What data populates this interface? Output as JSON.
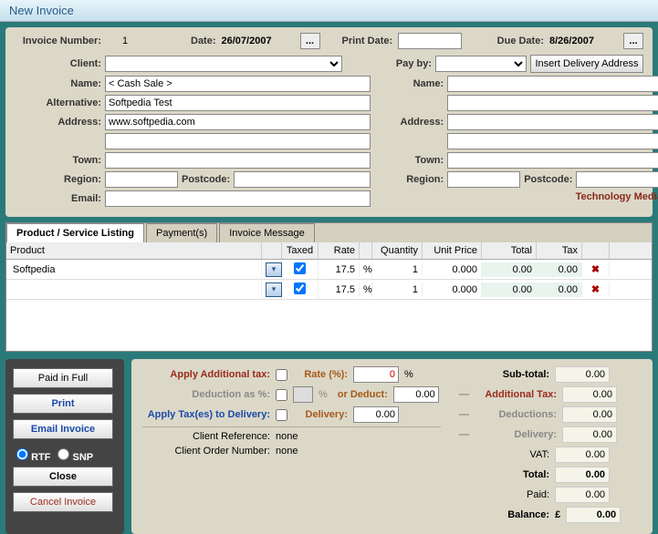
{
  "title": "New Invoice",
  "header": {
    "invoice_number_label": "Invoice Number:",
    "invoice_number": "1",
    "date_label": "Date:",
    "date": "26/07/2007",
    "print_date_label": "Print Date:",
    "print_date": "",
    "due_date_label": "Due Date:",
    "due_date": "8/26/2007",
    "ellipsis": "..."
  },
  "client_row": {
    "client_label": "Client:",
    "payby_label": "Pay by:",
    "insert_btn": "Insert Delivery Address"
  },
  "left": {
    "name_label": "Name:",
    "name": "< Cash Sale >",
    "alt_label": "Alternative:",
    "alt": "Softpedia Test",
    "addr_label": "Address:",
    "addr": "www.softpedia.com",
    "town_label": "Town:",
    "region_label": "Region:",
    "postcode_label": "Postcode:",
    "email_label": "Email:"
  },
  "right": {
    "name_label": "Name:",
    "addr_label": "Address:",
    "town_label": "Town:",
    "region_label": "Region:",
    "postcode_label": "Postcode:"
  },
  "footer_note": "Technology Media, Bradford.",
  "tabs": {
    "t1": "Product / Service Listing",
    "t2": "Payment(s)",
    "t3": "Invoice Message"
  },
  "grid": {
    "h_product": "Product",
    "h_taxed": "Taxed",
    "h_rate": "Rate",
    "h_qty": "Quantity",
    "h_up": "Unit Price",
    "h_total": "Total",
    "h_tax": "Tax",
    "pct": "%",
    "rows": [
      {
        "product": "Softpedia",
        "taxed": true,
        "rate": "17.5",
        "qty": "1",
        "up": "0.000",
        "total": "0.00",
        "tax": "0.00"
      },
      {
        "product": "",
        "taxed": true,
        "rate": "17.5",
        "qty": "1",
        "up": "0.000",
        "total": "0.00",
        "tax": "0.00"
      }
    ]
  },
  "buttons": {
    "paid": "Paid in Full",
    "print": "Print",
    "email": "Email Invoice",
    "rtf": "RTF",
    "snp": "SNP",
    "close": "Close",
    "cancel": "Cancel  Invoice"
  },
  "calc": {
    "apply_add_tax": "Apply Additional tax:",
    "rate_pct": "Rate (%):",
    "rate_val": "0",
    "pct": "%",
    "deduction_as": "Deduction as %:",
    "or_deduct": "or Deduct:",
    "deduct_val": "0.00",
    "apply_delivery": "Apply Tax(es) to Delivery:",
    "delivery": "Delivery:",
    "delivery_val": "0.00",
    "client_ref_label": "Client Reference:",
    "client_ref": "none",
    "client_order_label": "Client Order Number:",
    "client_order": "none"
  },
  "totals": {
    "subtotal_lbl": "Sub-total:",
    "subtotal": "0.00",
    "addtax_lbl": "Additional Tax:",
    "addtax": "0.00",
    "deduct_lbl": "Deductions:",
    "deduct": "0.00",
    "delivery_lbl": "Delivery:",
    "delivery": "0.00",
    "vat_lbl": "VAT:",
    "vat": "0.00",
    "total_lbl": "Total:",
    "total": "0.00",
    "paid_lbl": "Paid:",
    "paid": "0.00",
    "balance_lbl": "Balance:",
    "currency": "£",
    "balance": "0.00",
    "dash": "—"
  }
}
